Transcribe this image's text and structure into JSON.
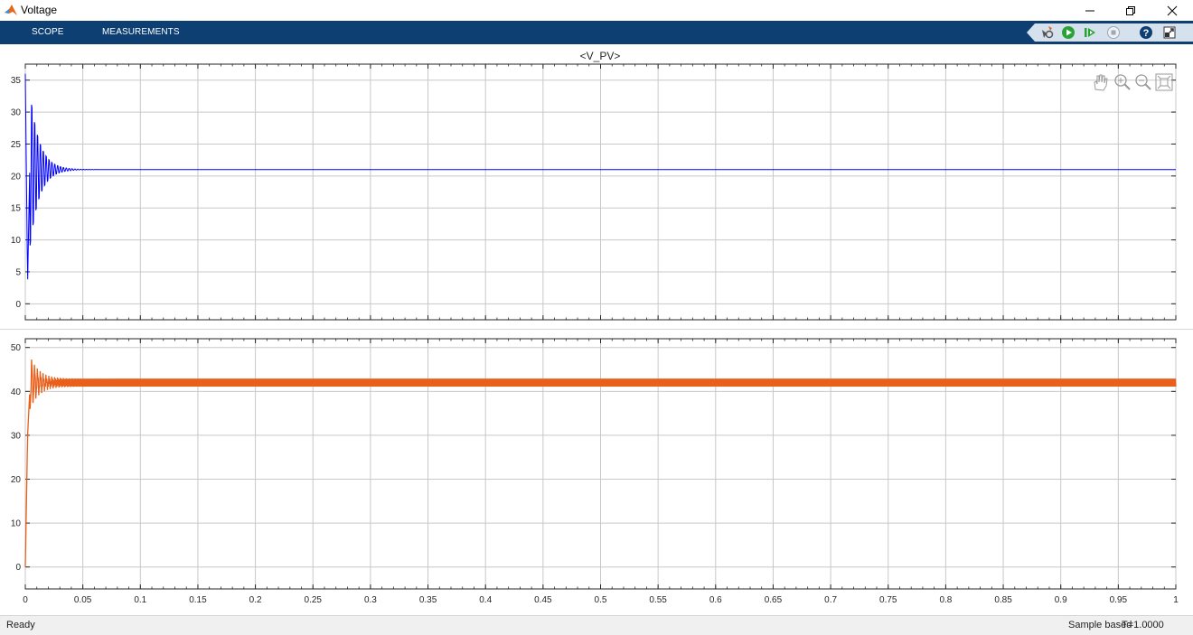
{
  "window": {
    "title": "Voltage"
  },
  "toolstrip": {
    "tabs": [
      "SCOPE",
      "MEASUREMENTS"
    ]
  },
  "toolbar_icons": [
    "signal-hilite-icon",
    "run-icon",
    "step-forward-icon",
    "stop-icon",
    "help-icon",
    "undock-icon"
  ],
  "zoom_icons": [
    "pan-icon",
    "zoom-in-icon",
    "zoom-out-icon",
    "fit-to-view-icon"
  ],
  "status": {
    "left": "Ready",
    "mode": "Sample based",
    "time": "T=1.0000"
  },
  "colors": {
    "toolstrip": "#0d3f73",
    "series_top": "#0000ff",
    "series_bottom": "#e8601c"
  },
  "chart_data": [
    {
      "type": "line",
      "title": "<V_PV>",
      "xlim": [
        0,
        1
      ],
      "ylim": [
        -2.5,
        37.5
      ],
      "x_ticks": [
        "0",
        "0.05",
        "0.1",
        "0.15",
        "0.2",
        "0.25",
        "0.3",
        "0.35",
        "0.4",
        "0.45",
        "0.5",
        "0.55",
        "0.6",
        "0.65",
        "0.7",
        "0.75",
        "0.8",
        "0.85",
        "0.9",
        "0.95",
        "1"
      ],
      "y_ticks": [
        "0",
        "5",
        "10",
        "15",
        "20",
        "25",
        "30",
        "35"
      ],
      "grid": true,
      "series": [
        {
          "color": "#0000ff",
          "x": [
            0,
            0.002,
            0.005,
            0.01,
            0.02,
            0.03,
            0.05,
            0.1,
            0.2,
            0.3,
            0.5,
            0.6,
            1
          ],
          "values": [
            36,
            3,
            33,
            21,
            21,
            21,
            21,
            21,
            21,
            21,
            21,
            21,
            21
          ]
        }
      ]
    },
    {
      "type": "line",
      "title": "",
      "xlim": [
        0,
        1
      ],
      "ylim": [
        -5,
        52
      ],
      "x_ticks": [
        "0",
        "0.05",
        "0.1",
        "0.15",
        "0.2",
        "0.25",
        "0.3",
        "0.35",
        "0.4",
        "0.45",
        "0.5",
        "0.55",
        "0.6",
        "0.65",
        "0.7",
        "0.75",
        "0.8",
        "0.85",
        "0.9",
        "0.95",
        "1"
      ],
      "y_ticks": [
        "0",
        "10",
        "20",
        "30",
        "40",
        "50"
      ],
      "grid": true,
      "series": [
        {
          "color": "#e8601c",
          "x": [
            0,
            0.002,
            0.005,
            0.01,
            0.02,
            0.03,
            0.05,
            0.1,
            0.5,
            1
          ],
          "values": [
            0,
            30,
            46,
            33,
            44,
            42,
            42,
            42,
            42,
            42
          ]
        }
      ]
    }
  ]
}
